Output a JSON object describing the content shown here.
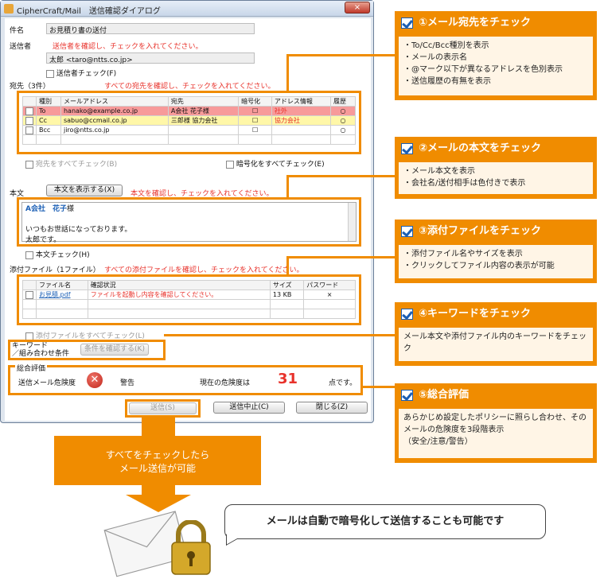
{
  "dialog": {
    "title": "CipherCraft/Mail　送信確認ダイアログ",
    "close_glyph": "×",
    "subject_label": "件名",
    "subject_value": "お見積り書の送付",
    "sender_label": "送信者",
    "sender_instruction": "送信者を確認し、チェックを入れてください。",
    "sender_value": "太郎 <taro@ntts.co.jp>",
    "sender_check_label": "送信者チェック(F)",
    "recipients_label": "宛先（3件）",
    "recipients_instruction": "すべての宛先を確認し、チェックを入れてください。",
    "recipients_columns": [
      "種別",
      "メールアドレス",
      "宛先",
      "暗号化",
      "アドレス情報",
      "履歴"
    ],
    "recipients": [
      {
        "type": "To",
        "email": "hanako@example.co.jp",
        "name": "A会社 花子様",
        "encrypt": "☐",
        "info": "社外",
        "history": "○",
        "bg": "#f79a9a"
      },
      {
        "type": "Cc",
        "email": "sabuo@ccmail.co.jp",
        "name": "三郎様 協力会社",
        "encrypt": "☐",
        "info": "協力会社",
        "history": "○",
        "bg": "#fff7a8"
      },
      {
        "type": "Bcc",
        "email": "jiro@ntts.co.jp",
        "name": "",
        "encrypt": "☐",
        "info": "",
        "history": "○",
        "bg": "#ffffff"
      }
    ],
    "check_all_recipients": "宛先をすべてチェック(B)",
    "encrypt_all": "暗号化をすべてチェック(E)",
    "body_label": "本文",
    "show_body_button": "本文を表示する(X)",
    "body_instruction": "本文を確認し、チェックを入れてください。",
    "body_line1_company": "A会社",
    "body_line1_name": "花子",
    "body_line1_suffix": "様",
    "body_line2": "いつもお世話になっております。",
    "body_line3": "太郎です。",
    "body_check_label": "本文チェック(H)",
    "attach_label": "添付ファイル（1ファイル）",
    "attach_instruction": "すべての添付ファイルを確認し、チェックを入れてください。",
    "attach_columns": [
      "ファイル名",
      "確認状況",
      "サイズ",
      "パスワード"
    ],
    "attachments": [
      {
        "name": "お見積.pdf",
        "status": "ファイルを起動し内容を確認してください。",
        "size": "13 KB",
        "password": "×"
      }
    ],
    "check_all_attach": "添付ファイルをすべてチェック(L)",
    "keyword_label1": "キーワード",
    "keyword_label2": "／組み合わせ条件",
    "keyword_button": "条件を確認する(K)",
    "overall_label": "総合評価",
    "risk_label": "送信メール危険度",
    "warning_label": "警告",
    "risk_text": "現在の危険度は",
    "risk_value": "31",
    "risk_unit": "点です。",
    "send_button": "送信(S)",
    "cancel_button": "送信中止(C)",
    "close_button": "閉じる(Z)"
  },
  "annotations": [
    {
      "title": "①メール宛先をチェック",
      "lines": [
        "・To/Cc/Bcc種別を表示",
        "・メールの表示名",
        "・@マーク以下が異なるアドレスを色別表示",
        "・送信履歴の有無を表示"
      ]
    },
    {
      "title": "②メールの本文をチェック",
      "lines": [
        "・メール本文を表示",
        "・会社名/送付相手は色付きで表示"
      ]
    },
    {
      "title": "③添付ファイルをチェック",
      "lines": [
        "・添付ファイル名やサイズを表示",
        "・クリックしてファイル内容の表示が可能"
      ]
    },
    {
      "title": "④キーワードをチェック",
      "lines": [
        "メール本文や添付ファイル内のキーワードをチェック"
      ]
    },
    {
      "title": "⑤総合評価",
      "lines": [
        "あらかじめ設定したポリシーに照らし合わせ、そのメールの危険度を3段階表示",
        "（安全/注意/警告）"
      ]
    }
  ],
  "bottom": {
    "arrow_text1": "すべてをチェックしたら",
    "arrow_text2": "メール送信が可能",
    "callout": "メールは自動で暗号化して送信することも可能です"
  },
  "colors": {
    "accent": "#f08c00",
    "danger": "#e8322b",
    "link": "#1b5fb5"
  }
}
